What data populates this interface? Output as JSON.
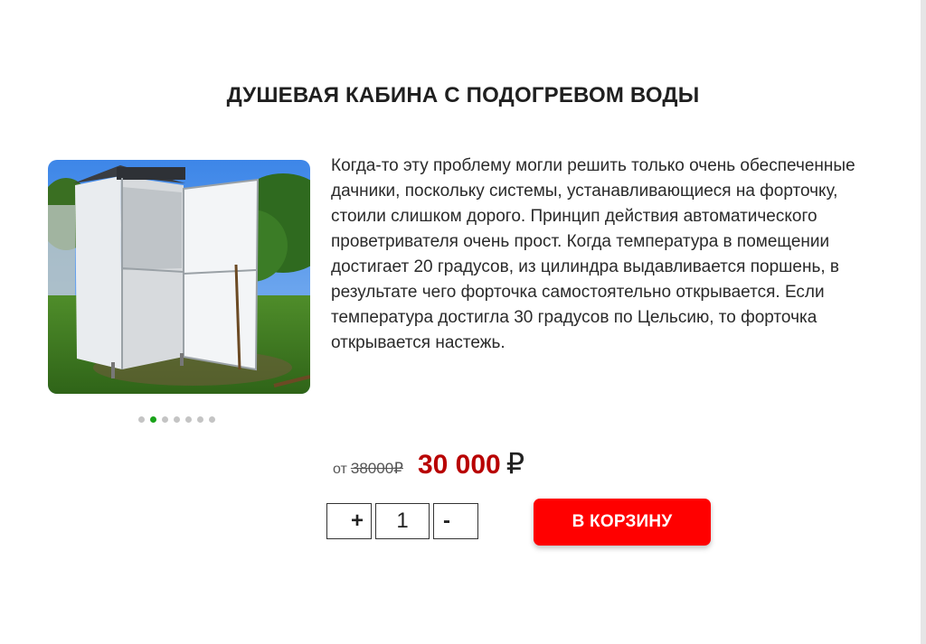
{
  "product": {
    "title": "ДУШЕВАЯ КАБИНА С ПОДОГРЕВОМ ВОДЫ",
    "description": "Когда-то эту проблему могли решить только очень обеспеченные дачники, поскольку системы, устанавливающиеся на форточку, стоили слишком дорого. Принцип действия автоматического проветривателя очень прост. Когда температура в помещении достигает 20 градусов, из цилиндра выдавливается поршень, в результате чего форточка самостоятельно открывается. Если температура достигла 30 градусов по Цельсию, то форточка открывается настежь."
  },
  "gallery": {
    "slide_count": 7,
    "active_index": 1
  },
  "price": {
    "from_label": "от",
    "old_price": "38000₽",
    "new_price": "30 000",
    "currency_symbol": "₽"
  },
  "quantity": {
    "plus_label": "+",
    "value": "1",
    "minus_label": "-"
  },
  "cart_button": {
    "label": "В КОРЗИНУ"
  },
  "colors": {
    "accent": "#ff0000",
    "price": "#b80000",
    "active_dot": "#1aa31a"
  }
}
